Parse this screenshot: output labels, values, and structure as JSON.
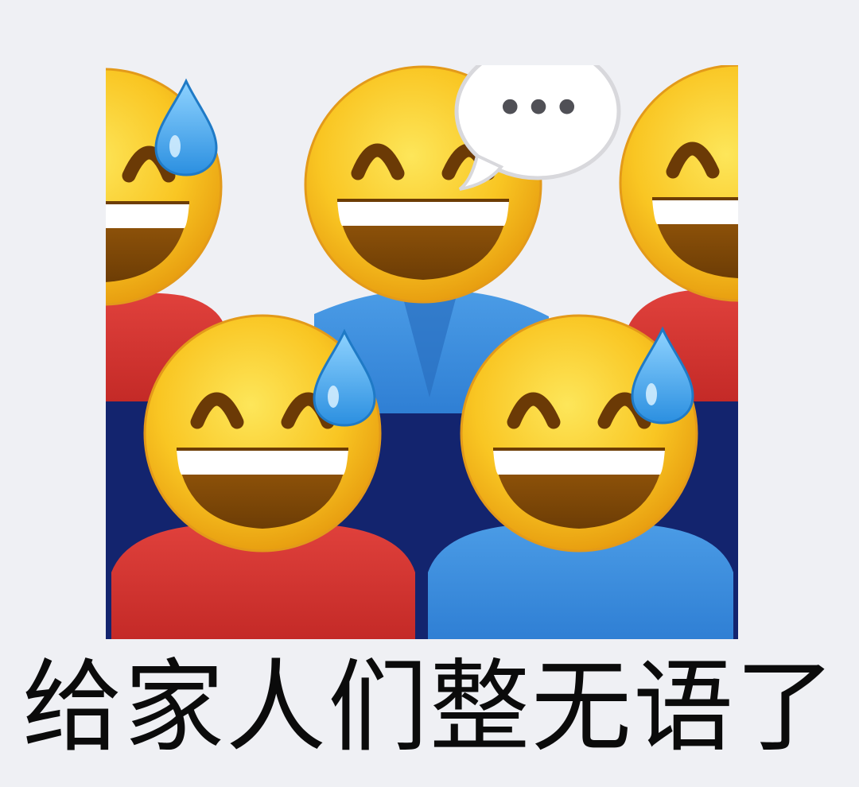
{
  "meme": {
    "caption": "给家人们整无语了",
    "speech_bubble_text": "•••",
    "figures": [
      {
        "role": "back-left",
        "shirt_color": "#d2302d",
        "sweat_drop": true,
        "cropped": "left"
      },
      {
        "role": "back-center",
        "shirt_color": "#3a8ad8",
        "sweat_drop": false,
        "speech_bubble": true
      },
      {
        "role": "back-right",
        "shirt_color": "#d2302d",
        "sweat_drop": false,
        "cropped": "right"
      },
      {
        "role": "front-left",
        "shirt_color": "#d83a35",
        "sweat_drop": true
      },
      {
        "role": "front-right",
        "shirt_color": "#3e90e0",
        "sweat_drop": true
      }
    ],
    "colors": {
      "page_background": "#eff0f4",
      "backdrop_blue": "#13246e",
      "face_yellow": "#f9c623",
      "mouth_brown": "#8a5108",
      "teeth_white": "#ffffff",
      "sweat_blue": "#4aaef2",
      "caption_text": "#0b0b0b"
    },
    "icons": [
      "grinning-sweat-face-icon",
      "grinning-face-icon",
      "speech-bubble-icon",
      "sweat-drop-icon"
    ]
  }
}
